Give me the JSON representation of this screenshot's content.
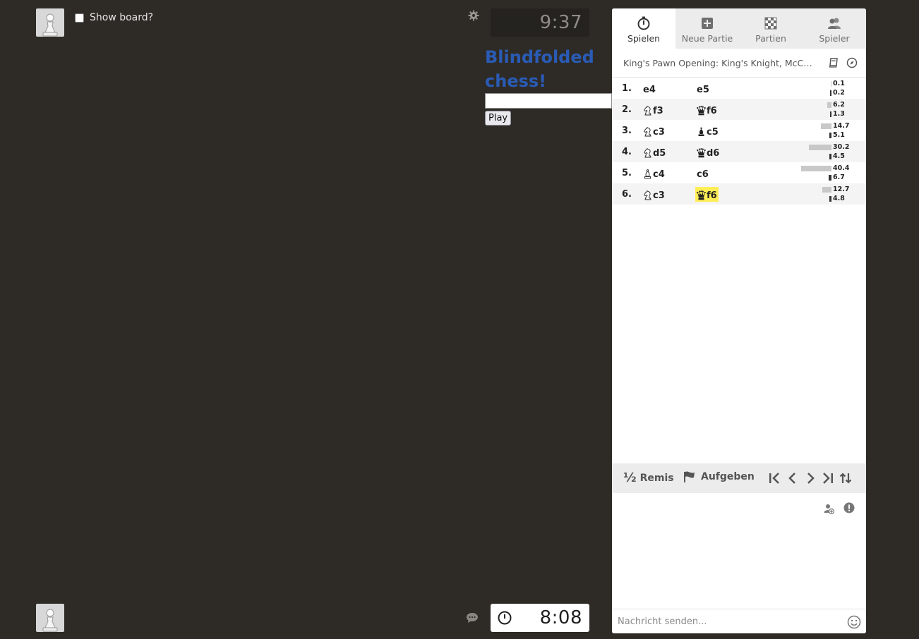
{
  "top_player": {
    "show_board_label": "Show board?",
    "clock": "9:37"
  },
  "bottom_player": {
    "clock": "8:08"
  },
  "blindfold": {
    "title": "Blindfolded chess!",
    "input_value": "",
    "play_label": "Play"
  },
  "tabs": [
    {
      "label": "Spielen",
      "icon": "stopwatch-icon",
      "active": true
    },
    {
      "label": "Neue Partie",
      "icon": "plus-square-icon",
      "active": false
    },
    {
      "label": "Partien",
      "icon": "chessboard-icon",
      "active": false
    },
    {
      "label": "Spieler",
      "icon": "players-icon",
      "active": false
    }
  ],
  "opening": {
    "name": "King's Pawn Opening: King's Knight, McConnell Defense"
  },
  "moves": [
    {
      "num": "1.",
      "white": "e4",
      "white_piece": "",
      "black": "e5",
      "black_piece": "",
      "white_time": "0.1",
      "black_time": "0.2",
      "white_frac": 0.003,
      "black_frac": 0.03
    },
    {
      "num": "2.",
      "white": "f3",
      "white_piece": "knight",
      "black": "f6",
      "black_piece": "queen",
      "white_time": "6.2",
      "black_time": "1.3",
      "white_frac": 0.15,
      "black_frac": 0.19
    },
    {
      "num": "3.",
      "white": "c3",
      "white_piece": "knight",
      "black": "c5",
      "black_piece": "bishop",
      "white_time": "14.7",
      "black_time": "5.1",
      "white_frac": 0.36,
      "black_frac": 0.76
    },
    {
      "num": "4.",
      "white": "d5",
      "white_piece": "knight",
      "black": "d6",
      "black_piece": "queen",
      "white_time": "30.2",
      "black_time": "4.5",
      "white_frac": 0.75,
      "black_frac": 0.67
    },
    {
      "num": "5.",
      "white": "c4",
      "white_piece": "bishop",
      "black": "c6",
      "black_piece": "",
      "white_time": "40.4",
      "black_time": "6.7",
      "white_frac": 1.0,
      "black_frac": 1.0
    },
    {
      "num": "6.",
      "white": "c3",
      "white_piece": "knight",
      "black": "f6",
      "black_piece": "queen",
      "white_time": "12.7",
      "black_time": "4.8",
      "white_frac": 0.31,
      "black_frac": 0.72,
      "current": "black"
    }
  ],
  "controls": {
    "draw_label": "Remis",
    "draw_glyph": "½",
    "resign_label": "Aufgeben"
  },
  "chat": {
    "placeholder": "Nachricht senden..."
  },
  "colors": {
    "background": "#2e2b27",
    "title_blue": "#2a5bb5",
    "highlight": "#ffee55"
  }
}
